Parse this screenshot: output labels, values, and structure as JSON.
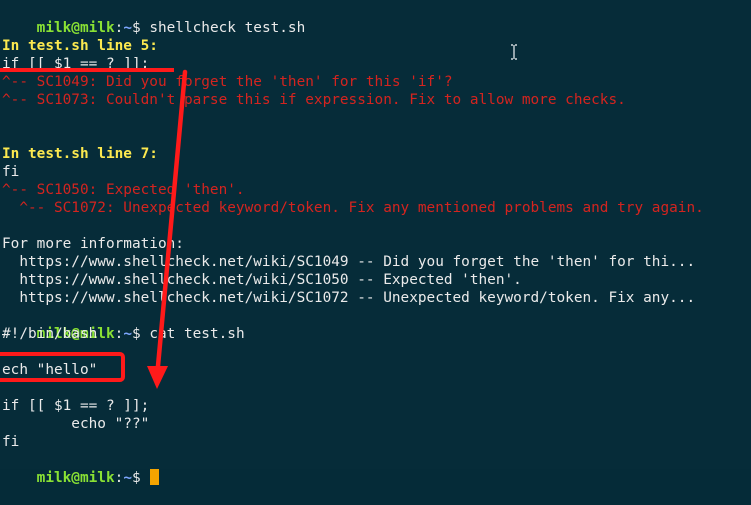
{
  "terminal": {
    "prompt": {
      "user": "milk@milk",
      "sep": ":",
      "path": "~",
      "symbol": "$ "
    },
    "lines": {
      "l0_cmd": "shellcheck test.sh",
      "l2_header": "In test.sh line 5:",
      "l3_code": "if [[ $1 == ? ]];",
      "l4_err": "^-- SC1049: Did you forget the 'then' for this 'if'?",
      "l5_err": "^-- SC1073: Couldn't parse this if expression. Fix to allow more checks.",
      "l8_header": "In test.sh line 7:",
      "l9_code": "fi",
      "l10_err": "^-- SC1050: Expected 'then'.",
      "l11_err": "  ^-- SC1072: Unexpected keyword/token. Fix any mentioned problems and try again.",
      "l13_info": "For more information:",
      "l14_link": "  https://www.shellcheck.net/wiki/SC1049 -- Did you forget the 'then' for thi...",
      "l15_link": "  https://www.shellcheck.net/wiki/SC1050 -- Expected 'then'.",
      "l16_link": "  https://www.shellcheck.net/wiki/SC1072 -- Unexpected keyword/token. Fix any...",
      "l17_cmd": "cat test.sh",
      "l18_shebang": "#!/bin/bash",
      "l20_echo": "ech \"hello\"",
      "l22_if": "if [[ $1 == ? ]];",
      "l23_echo": "        echo \"??\"",
      "l24_fi": "fi"
    },
    "colors": {
      "background": "#062c39",
      "prompt_user": "#8ae234",
      "prompt_path": "#7da7ff",
      "header": "#fce94f",
      "error": "#d4241f",
      "text": "#eaeaea",
      "annotation": "#ff1a1a",
      "cursor": "#f5a400"
    },
    "icons": {
      "text_cursor": "ibeam-cursor-icon",
      "annotation_arrow": "arrow-down-icon"
    }
  }
}
